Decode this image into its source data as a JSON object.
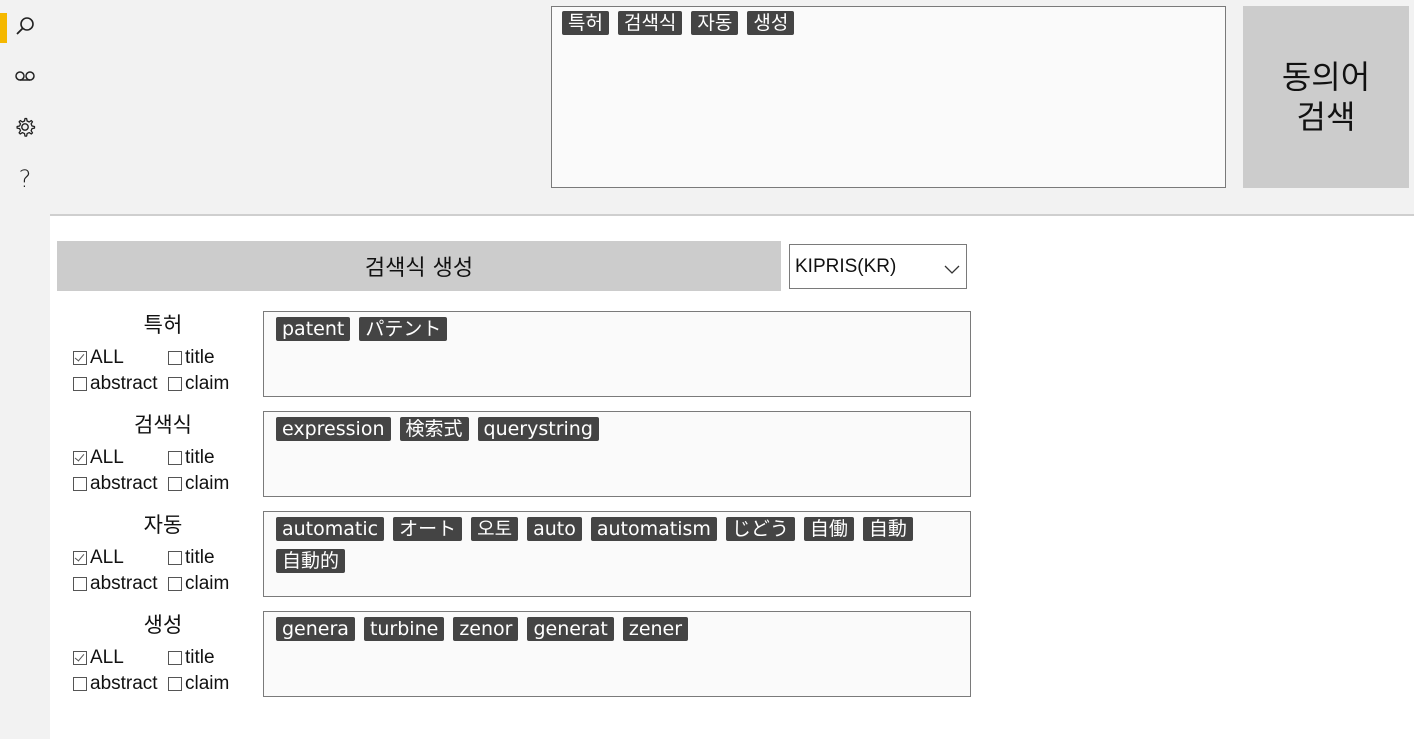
{
  "nav": {
    "items": [
      {
        "name": "search",
        "selected": true
      },
      {
        "name": "voicemail",
        "selected": false
      },
      {
        "name": "settings",
        "selected": false
      },
      {
        "name": "help",
        "selected": false
      }
    ],
    "help_glyph": "?"
  },
  "keywords": [
    "특허",
    "검색식",
    "자동",
    "생성"
  ],
  "synonym_button": {
    "line1": "동의어",
    "line2": "검색"
  },
  "generate_button": "검색식 생성",
  "database_select": {
    "value": "KIPRIS(KR)"
  },
  "terms": [
    {
      "title": "특허",
      "options": {
        "all": "ALL",
        "title": "title",
        "abstract": "abstract",
        "claim": "claim"
      },
      "checked": {
        "all": true,
        "title": false,
        "abstract": false,
        "claim": false
      },
      "synonyms": [
        "patent",
        "パテント"
      ]
    },
    {
      "title": "검색식",
      "options": {
        "all": "ALL",
        "title": "title",
        "abstract": "abstract",
        "claim": "claim"
      },
      "checked": {
        "all": true,
        "title": false,
        "abstract": false,
        "claim": false
      },
      "synonyms": [
        "expression",
        "検索式",
        "querystring"
      ]
    },
    {
      "title": "자동",
      "options": {
        "all": "ALL",
        "title": "title",
        "abstract": "abstract",
        "claim": "claim"
      },
      "checked": {
        "all": true,
        "title": false,
        "abstract": false,
        "claim": false
      },
      "synonyms": [
        "automatic",
        "オート",
        "오토",
        "auto",
        "automatism",
        "じどう",
        "自働",
        "自動",
        "自動的"
      ]
    },
    {
      "title": "생성",
      "options": {
        "all": "ALL",
        "title": "title",
        "abstract": "abstract",
        "claim": "claim"
      },
      "checked": {
        "all": true,
        "title": false,
        "abstract": false,
        "claim": false
      },
      "synonyms": [
        "genera",
        "turbine",
        "zenor",
        "generat",
        "zener"
      ]
    }
  ],
  "colors": {
    "accent": "#f5b800",
    "chip": "#444444",
    "button": "#cccccc"
  }
}
